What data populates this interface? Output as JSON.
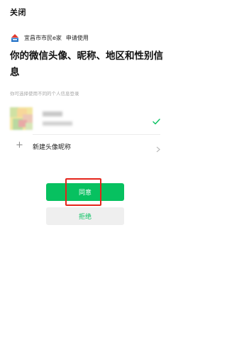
{
  "header": {
    "close_label": "关闭"
  },
  "app": {
    "name": "宜昌市市民e家",
    "request_label": "申请使用",
    "logo_icon": "city-emblem-icon"
  },
  "heading": "你的微信头像、昵称、地区和性别信息",
  "hint": "你可选择使用不同的个人信息登录",
  "account": {
    "avatar_icon": "avatar-image",
    "selected": true,
    "check_icon": "checkmark-icon"
  },
  "new_profile": {
    "label": "新建头像昵称",
    "plus_icon": "plus-icon",
    "chevron_icon": "chevron-right-icon"
  },
  "buttons": {
    "agree_label": "同意",
    "reject_label": "拒绝"
  },
  "colors": {
    "primary": "#07c160",
    "reject_bg": "#efefef",
    "highlight": "#e5241b",
    "hint": "#a7a7a7"
  }
}
